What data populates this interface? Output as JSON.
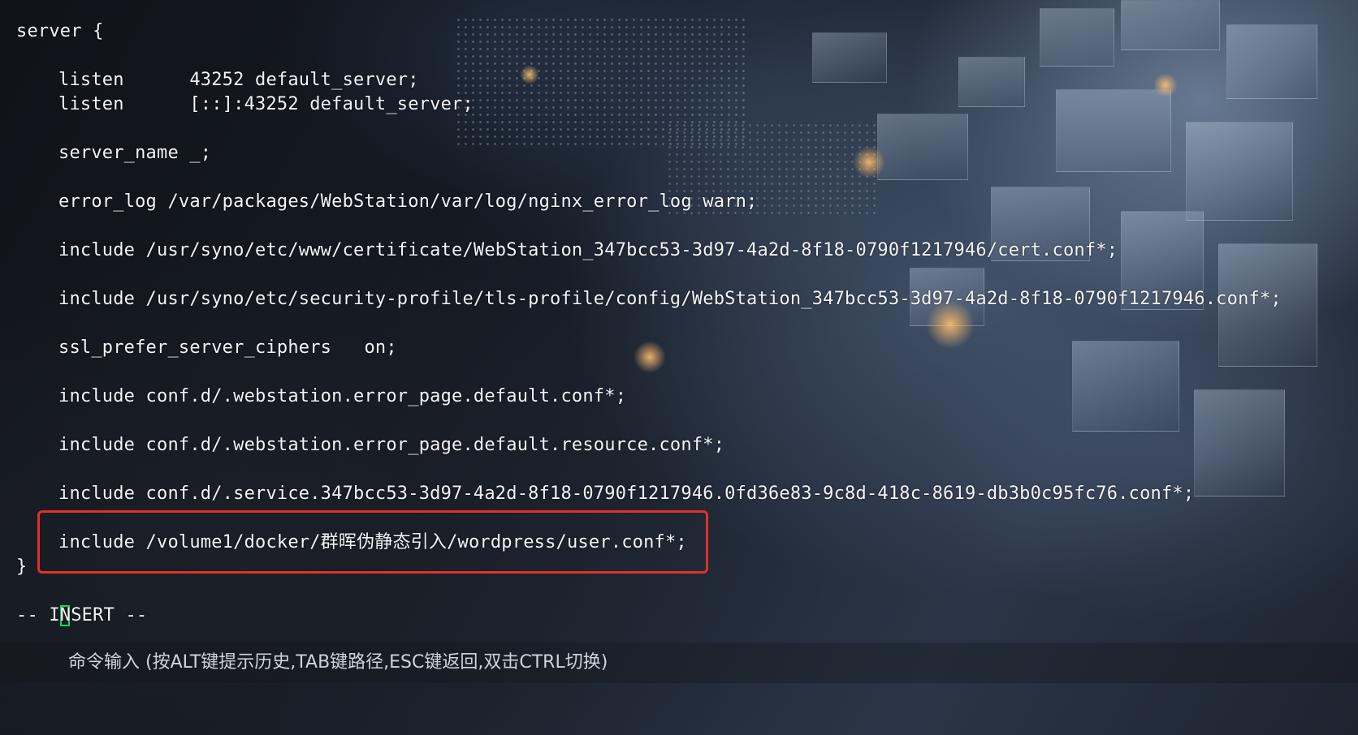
{
  "editor": {
    "lines": [
      "server {",
      "",
      "listen      43252 default_server;",
      "listen      [::]:43252 default_server;",
      "",
      "server_name _;",
      "",
      "error_log /var/packages/WebStation/var/log/nginx_error_log warn;",
      "",
      "include /usr/syno/etc/www/certificate/WebStation_347bcc53-3d97-4a2d-8f18-0790f1217946/cert.conf*;",
      "",
      "include /usr/syno/etc/security-profile/tls-profile/config/WebStation_347bcc53-3d97-4a2d-8f18-0790f1217946.conf*;",
      "",
      "ssl_prefer_server_ciphers   on;",
      "",
      "include conf.d/.webstation.error_page.default.conf*;",
      "",
      "include conf.d/.webstation.error_page.default.resource.conf*;",
      "",
      "include conf.d/.service.347bcc53-3d97-4a2d-8f18-0790f1217946.0fd36e83-9c8d-418c-8619-db3b0c95fc76.conf*;",
      "",
      "include /volume1/docker/群晖伪静态引入/wordpress/user.conf*;",
      "}"
    ],
    "mode_indicator": "-- INSERT --",
    "highlight_color": "#e3302a",
    "cursor_color": "#19d46a"
  },
  "command_bar": {
    "placeholder": "命令输入 (按ALT键提示历史,TAB键路径,ESC键返回,双击CTRL切换)"
  }
}
